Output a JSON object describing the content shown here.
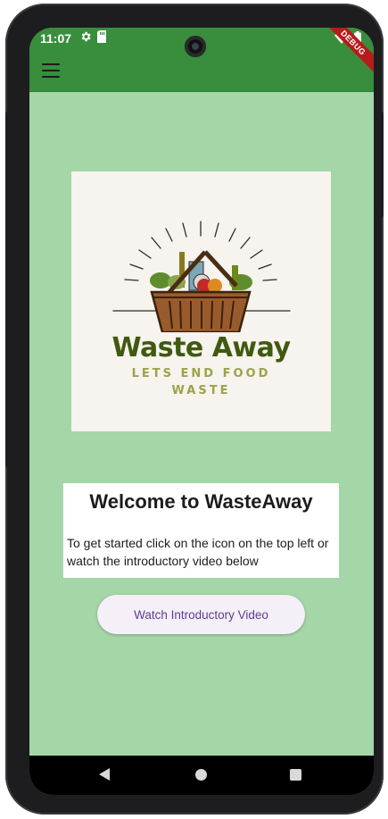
{
  "status_bar": {
    "time": "11:07",
    "icons_left": [
      "settings-gear-icon",
      "sd-card-icon"
    ],
    "icons_right": [
      "wifi-icon",
      "battery-icon"
    ]
  },
  "app_bar": {
    "menu_icon": "hamburger-menu-icon",
    "debug_banner": "DEBUG"
  },
  "logo": {
    "title": "Waste Away",
    "subtitle_line1": "LETS END FOOD",
    "subtitle_line2": "WASTE"
  },
  "welcome": {
    "title": "Welcome to WasteAway",
    "text": "To get started click on the icon on the top left or watch the introductory video below"
  },
  "video_button": {
    "label": "Watch Introductory Video"
  },
  "nav_bar": {
    "icons": [
      "back-icon",
      "home-icon",
      "recents-icon"
    ]
  },
  "colors": {
    "app_bar": "#388e3c",
    "background": "#a5d6a7",
    "logo_title": "#3f5a0f",
    "logo_subtitle": "#9aa34a",
    "button_text": "#5b3d91",
    "button_bg": "#f5f0f8",
    "debug_banner": "#b71c1c"
  }
}
